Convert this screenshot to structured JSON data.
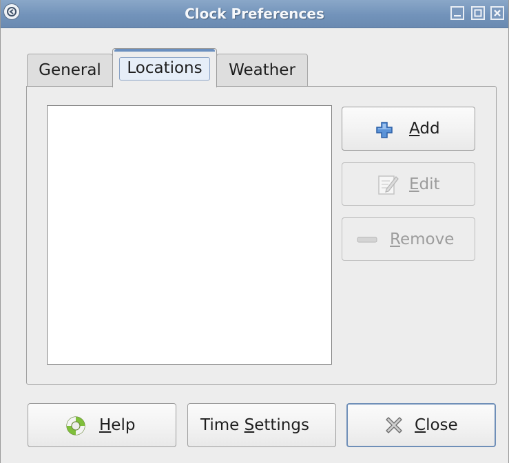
{
  "window": {
    "title": "Clock Preferences"
  },
  "tabs": [
    {
      "label": "General",
      "active": false
    },
    {
      "label": "Locations",
      "active": true
    },
    {
      "label": "Weather",
      "active": false
    }
  ],
  "locations_list": {
    "items": []
  },
  "side_buttons": {
    "add": {
      "pre": "",
      "accel": "A",
      "post": "dd",
      "icon": "plus-icon",
      "enabled": true
    },
    "edit": {
      "pre": "",
      "accel": "E",
      "post": "dit",
      "icon": "edit-icon",
      "enabled": false
    },
    "remove": {
      "pre": "",
      "accel": "R",
      "post": "emove",
      "icon": "minus-icon",
      "enabled": false
    }
  },
  "footer_buttons": {
    "help": {
      "pre": "",
      "accel": "H",
      "post": "elp",
      "icon": "lifebuoy-icon"
    },
    "time_settings": {
      "pre": "Time ",
      "accel": "S",
      "post": "ettings"
    },
    "close": {
      "pre": "",
      "accel": "C",
      "post": "lose",
      "icon": "close-x-icon"
    }
  },
  "colors": {
    "titlebar": "#7293ba",
    "window_bg": "#ededed",
    "active_tab_accent": "#6a8fbf",
    "add_icon": "#3b74c4"
  }
}
